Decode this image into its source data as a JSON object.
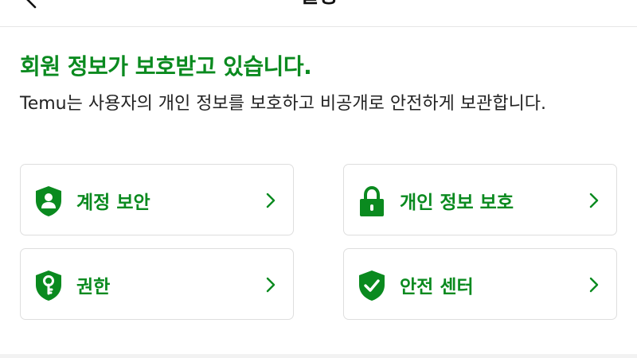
{
  "header": {
    "title": "설정",
    "back_icon": "back-arrow-icon"
  },
  "hero": {
    "title": "회원 정보가 보호받고 있습니다.",
    "description": "Temu는 사용자의 개인 정보를 보호하고 비공개로 안전하게 보관합니다."
  },
  "cards": [
    {
      "label": "계정 보안",
      "icon": "user-shield-icon"
    },
    {
      "label": "개인 정보 보호",
      "icon": "lock-icon"
    },
    {
      "label": "권한",
      "icon": "key-shield-icon"
    },
    {
      "label": "안전 센터",
      "icon": "check-shield-icon"
    }
  ],
  "colors": {
    "accent": "#0a8a1f",
    "text": "#222222",
    "border": "#dedede"
  }
}
